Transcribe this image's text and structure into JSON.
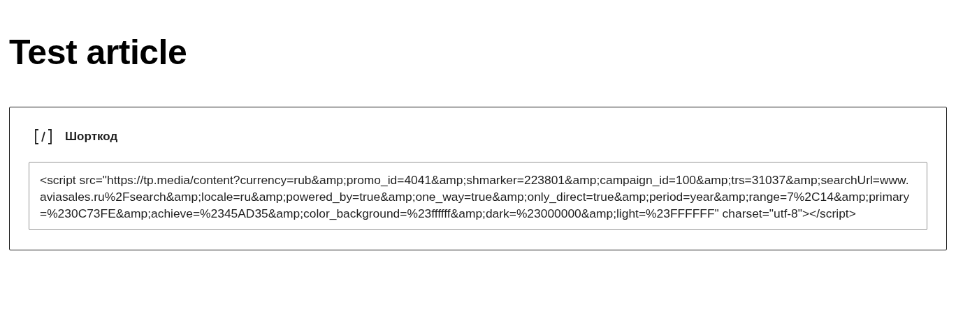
{
  "title": "Test article",
  "block": {
    "label": "Шорткод",
    "code": {
      "value": "<script src=\"https://tp.media/content?currency=rub&amp;promo_id=4041&amp;shmarker=223801&amp;campaign_id=100&amp;trs=31037&amp;searchUrl=www.aviasales.ru%2Fsearch&amp;locale=ru&amp;powered_by=true&amp;one_way=true&amp;only_direct=true&amp;period=year&amp;range=7%2C14&amp;primary=%230C73FE&amp;achieve=%2345AD35&amp;color_background=%23ffffff&amp;dark=%23000000&amp;light=%23FFFFFF\" charset=\"utf-8\"></script>"
    }
  }
}
